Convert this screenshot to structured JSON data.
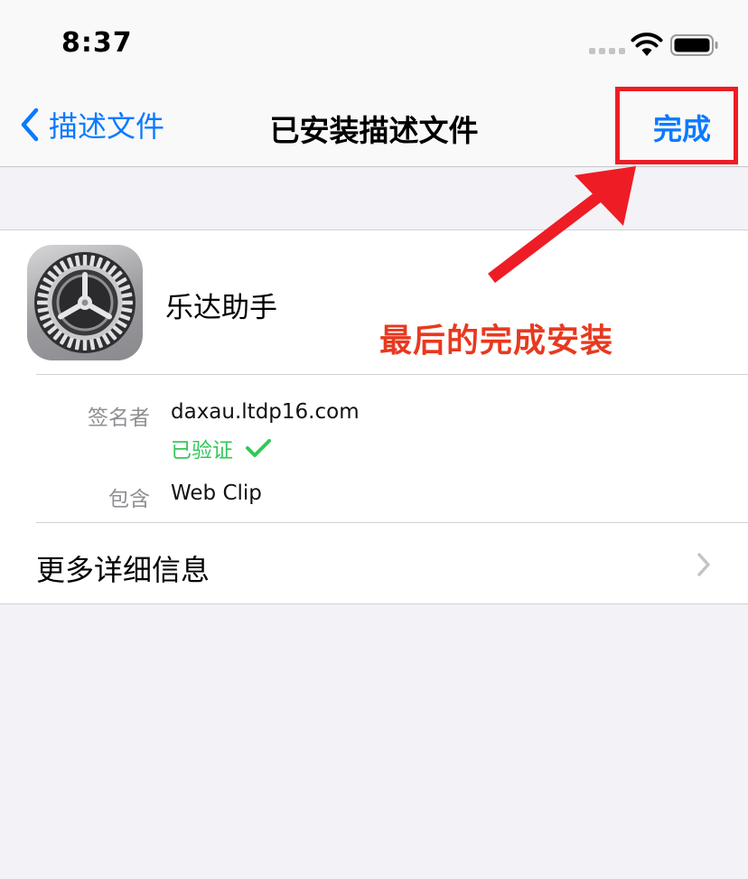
{
  "status_bar": {
    "time": "8:37"
  },
  "nav": {
    "back_label": "描述文件",
    "title": "已安装描述文件",
    "done_label": "完成"
  },
  "profile": {
    "app_name": "乐达助手",
    "icon": "settings-gear-icon",
    "signer_label": "签名者",
    "signer_value": "daxau.ltdp16.com",
    "verified_label": "已验证",
    "contains_label": "包含",
    "contains_value": "Web Clip",
    "more_details_label": "更多详细信息"
  },
  "annotation": {
    "text": "最后的完成安装",
    "color": "#e8391f"
  },
  "colors": {
    "accent": "#0a7aff",
    "verified": "#34c759",
    "highlight": "#ee1c25"
  }
}
